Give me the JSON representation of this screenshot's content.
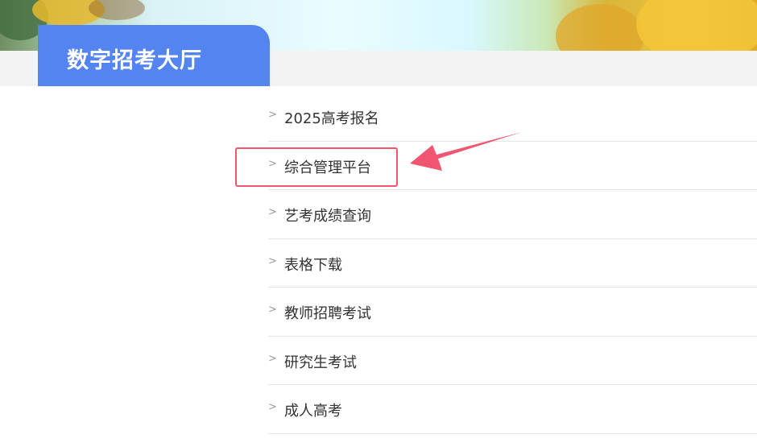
{
  "header": {
    "title": "数字招考大厅"
  },
  "menu": {
    "chevron": ">",
    "items": [
      {
        "label": "2025高考报名"
      },
      {
        "label": "综合管理平台"
      },
      {
        "label": "艺考成绩查询"
      },
      {
        "label": "表格下载"
      },
      {
        "label": "教师招聘考试"
      },
      {
        "label": "研究生考试"
      },
      {
        "label": "成人高考"
      }
    ]
  },
  "annotation": {
    "highlighted_item": "综合管理平台",
    "color": "#f0566f"
  },
  "colors": {
    "title_tab": "#5384ef",
    "gray_bar": "#f3f3f3",
    "divider": "#e6e6e6"
  },
  "icons": [
    "chevron-right-icon",
    "pointer-arrow-icon"
  ]
}
